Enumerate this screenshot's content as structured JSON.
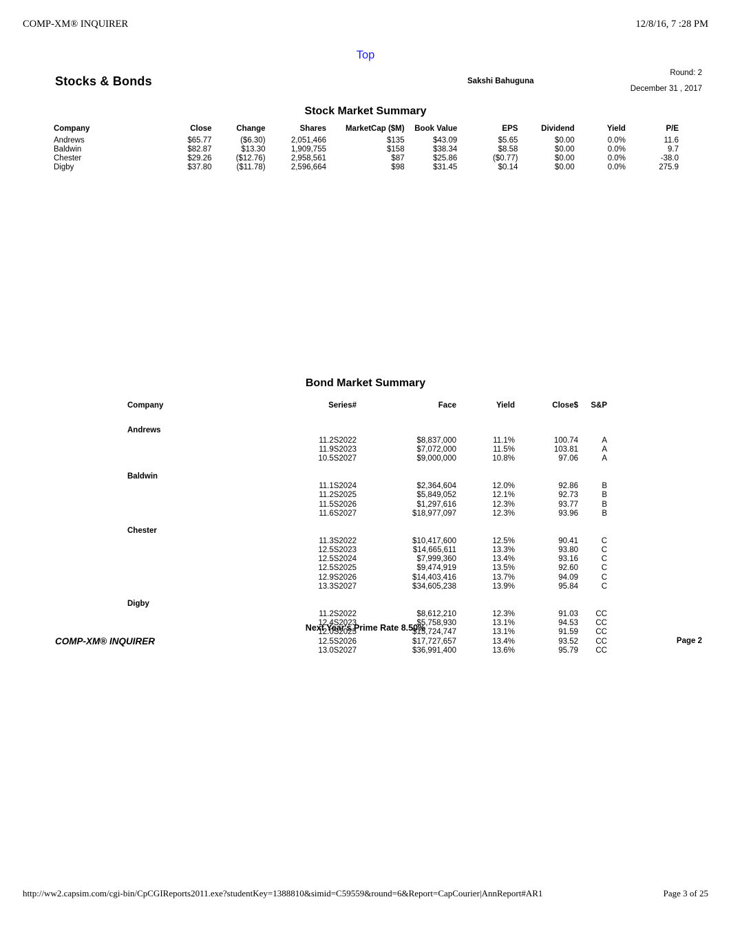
{
  "print_header": {
    "left": "COMP-XM® INQUIRER",
    "right": "12/8/16, 7  :28 PM"
  },
  "top_link": {
    "label": "Top",
    "color": "#1a1aff"
  },
  "report": {
    "title": "Stocks & Bonds",
    "student_name": "Sakshi Bahuguna",
    "round_label": "Round: 2",
    "round_date": "December 31 , 2017"
  },
  "stock_section": {
    "title": "Stock Market Summary",
    "columns": [
      "Company",
      "Close",
      "Change",
      "Shares",
      "MarketCap ($M)",
      "Book Value",
      "EPS",
      "Dividend",
      "Yield",
      "P/E"
    ],
    "rows": [
      {
        "company": "Andrews",
        "close": "$65.77",
        "change": "($6.30)",
        "shares": "2,051,466",
        "marketcap": "$135",
        "book_value": "$43.09",
        "eps": "$5.65",
        "dividend": "$0.00",
        "yield": "0.0%",
        "pe": "11.6"
      },
      {
        "company": "Baldwin",
        "close": "$82.87",
        "change": "$13.30",
        "shares": "1,909,755",
        "marketcap": "$158",
        "book_value": "$38.34",
        "eps": "$8.58",
        "dividend": "$0.00",
        "yield": "0.0%",
        "pe": "9.7"
      },
      {
        "company": "Chester",
        "close": "$29.26",
        "change": "($12.76)",
        "shares": "2,958,561",
        "marketcap": "$87",
        "book_value": "$25.86",
        "eps": "($0.77)",
        "dividend": "$0.00",
        "yield": "0.0%",
        "pe": "-38.0"
      },
      {
        "company": "Digby",
        "close": "$37.80",
        "change": "($11.78)",
        "shares": "2,596,664",
        "marketcap": "$98",
        "book_value": "$31.45",
        "eps": "$0.14",
        "dividend": "$0.00",
        "yield": "0.0%",
        "pe": "275.9"
      }
    ]
  },
  "bond_section": {
    "title": "Bond Market Summary",
    "columns": [
      "Company",
      "Series#",
      "Face",
      "Yield",
      "Close$",
      "S&P"
    ],
    "groups": [
      {
        "company": "Andrews",
        "bonds": [
          {
            "series": "11.2S2022",
            "face": "$8,837,000",
            "yield": "11.1%",
            "close": "100.74",
            "sp": "A"
          },
          {
            "series": "11.9S2023",
            "face": "$7,072,000",
            "yield": "11.5%",
            "close": "103.81",
            "sp": "A"
          },
          {
            "series": "10.5S2027",
            "face": "$9,000,000",
            "yield": "10.8%",
            "close": "97.06",
            "sp": "A"
          }
        ]
      },
      {
        "company": "Baldwin",
        "bonds": [
          {
            "series": "11.1S2024",
            "face": "$2,364,604",
            "yield": "12.0%",
            "close": "92.86",
            "sp": "B"
          },
          {
            "series": "11.2S2025",
            "face": "$5,849,052",
            "yield": "12.1%",
            "close": "92.73",
            "sp": "B"
          },
          {
            "series": "11.5S2026",
            "face": "$1,297,616",
            "yield": "12.3%",
            "close": "93.77",
            "sp": "B"
          },
          {
            "series": "11.6S2027",
            "face": "$18,977,097",
            "yield": "12.3%",
            "close": "93.96",
            "sp": "B"
          }
        ]
      },
      {
        "company": "Chester",
        "bonds": [
          {
            "series": "11.3S2022",
            "face": "$10,417,600",
            "yield": "12.5%",
            "close": "90.41",
            "sp": "C"
          },
          {
            "series": "12.5S2023",
            "face": "$14,665,611",
            "yield": "13.3%",
            "close": "93.80",
            "sp": "C"
          },
          {
            "series": "12.5S2024",
            "face": "$7,999,360",
            "yield": "13.4%",
            "close": "93.16",
            "sp": "C"
          },
          {
            "series": "12.5S2025",
            "face": "$9,474,919",
            "yield": "13.5%",
            "close": "92.60",
            "sp": "C"
          },
          {
            "series": "12.9S2026",
            "face": "$14,403,416",
            "yield": "13.7%",
            "close": "94.09",
            "sp": "C"
          },
          {
            "series": "13.3S2027",
            "face": "$34,605,238",
            "yield": "13.9%",
            "close": "95.84",
            "sp": "C"
          }
        ]
      },
      {
        "company": "Digby",
        "bonds": [
          {
            "series": "11.2S2022",
            "face": "$8,612,210",
            "yield": "12.3%",
            "close": "91.03",
            "sp": "CC"
          },
          {
            "series": "12.4S2023",
            "face": "$5,758,930",
            "yield": "13.1%",
            "close": "94.53",
            "sp": "CC"
          },
          {
            "series": "12.0S2025",
            "face": "$15,724,747",
            "yield": "13.1%",
            "close": "91.59",
            "sp": "CC"
          },
          {
            "series": "12.5S2026",
            "face": "$17,727,657",
            "yield": "13.4%",
            "close": "93.52",
            "sp": "CC"
          },
          {
            "series": "13.0S2027",
            "face": "$36,991,400",
            "yield": "13.6%",
            "close": "95.79",
            "sp": "CC"
          }
        ]
      }
    ]
  },
  "prime_rate": "Next Year's Prime Rate 8.50%",
  "report_footer": {
    "left": "COMP-XM® INQUIRER",
    "right": "Page 2"
  },
  "print_footer": {
    "url": "http://ww2.capsim.com/cgi-bin/CpCGIReports2011.exe?studentKey=1388810&simid=C59559&round=6&Report=CapCourier|AnnReport#AR1",
    "page": "Page 3 of 25"
  }
}
